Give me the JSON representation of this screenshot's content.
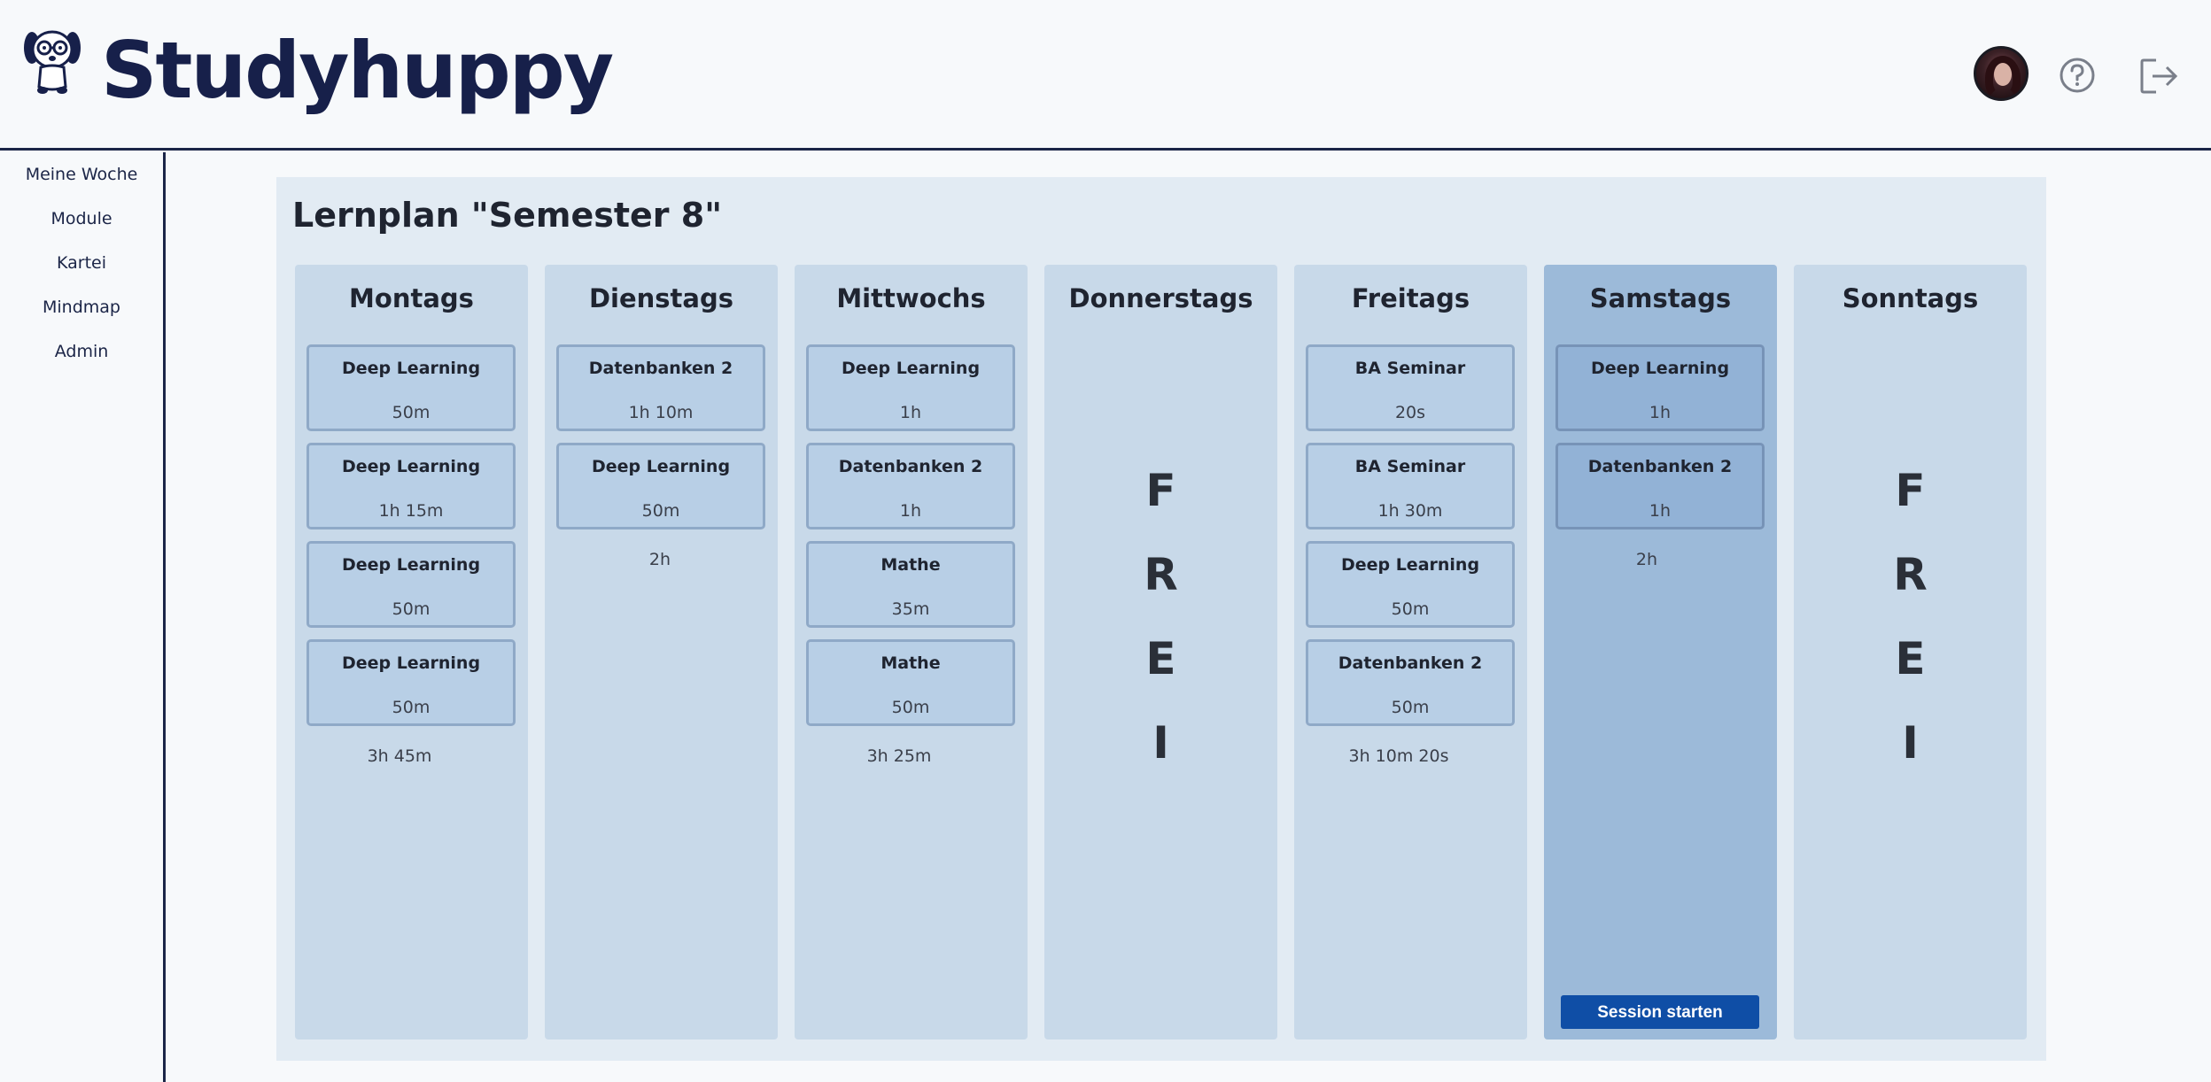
{
  "app": {
    "brand": "Studyhuppy",
    "logo_icon": "dog-with-glasses-icon",
    "avatar_icon": "user-avatar",
    "help_icon": "help-circle-icon",
    "logout_icon": "logout-icon"
  },
  "sidebar": {
    "items": [
      {
        "label": "Meine Woche"
      },
      {
        "label": "Module"
      },
      {
        "label": "Kartei"
      },
      {
        "label": "Mindmap"
      },
      {
        "label": "Admin"
      }
    ]
  },
  "plan": {
    "title": "Lernplan \"Semester 8\"",
    "days": [
      {
        "name": "Montags",
        "tasks": [
          {
            "name": "Deep Learning",
            "duration": "50m"
          },
          {
            "name": "Deep Learning",
            "duration": "1h 15m"
          },
          {
            "name": "Deep Learning",
            "duration": "50m"
          },
          {
            "name": "Deep Learning",
            "duration": "50m"
          }
        ],
        "total": "3h 45m"
      },
      {
        "name": "Dienstags",
        "tasks": [
          {
            "name": "Datenbanken 2",
            "duration": "1h 10m"
          },
          {
            "name": "Deep Learning",
            "duration": "50m"
          }
        ],
        "total": "2h"
      },
      {
        "name": "Mittwochs",
        "tasks": [
          {
            "name": "Deep Learning",
            "duration": "1h"
          },
          {
            "name": "Datenbanken 2",
            "duration": "1h"
          },
          {
            "name": "Mathe",
            "duration": "35m"
          },
          {
            "name": "Mathe",
            "duration": "50m"
          }
        ],
        "total": "3h 25m"
      },
      {
        "name": "Donnerstags",
        "free_letters": [
          "F",
          "R",
          "E",
          "I"
        ]
      },
      {
        "name": "Freitags",
        "tasks": [
          {
            "name": "BA Seminar",
            "duration": "20s"
          },
          {
            "name": "BA Seminar",
            "duration": "1h 30m"
          },
          {
            "name": "Deep Learning",
            "duration": "50m"
          },
          {
            "name": "Datenbanken 2",
            "duration": "50m"
          }
        ],
        "total": "3h 10m 20s"
      },
      {
        "name": "Samstags",
        "active": true,
        "tasks": [
          {
            "name": "Deep Learning",
            "duration": "1h"
          },
          {
            "name": "Datenbanken 2",
            "duration": "1h"
          }
        ],
        "total": "2h",
        "session_button": "Session starten"
      },
      {
        "name": "Sonntags",
        "free_letters": [
          "F",
          "R",
          "E",
          "I"
        ]
      }
    ]
  },
  "colors": {
    "brand": "#17204a",
    "day_bg": "#c8d9e9",
    "active_day_bg": "#9cbad9",
    "button": "#0f4ea6"
  }
}
